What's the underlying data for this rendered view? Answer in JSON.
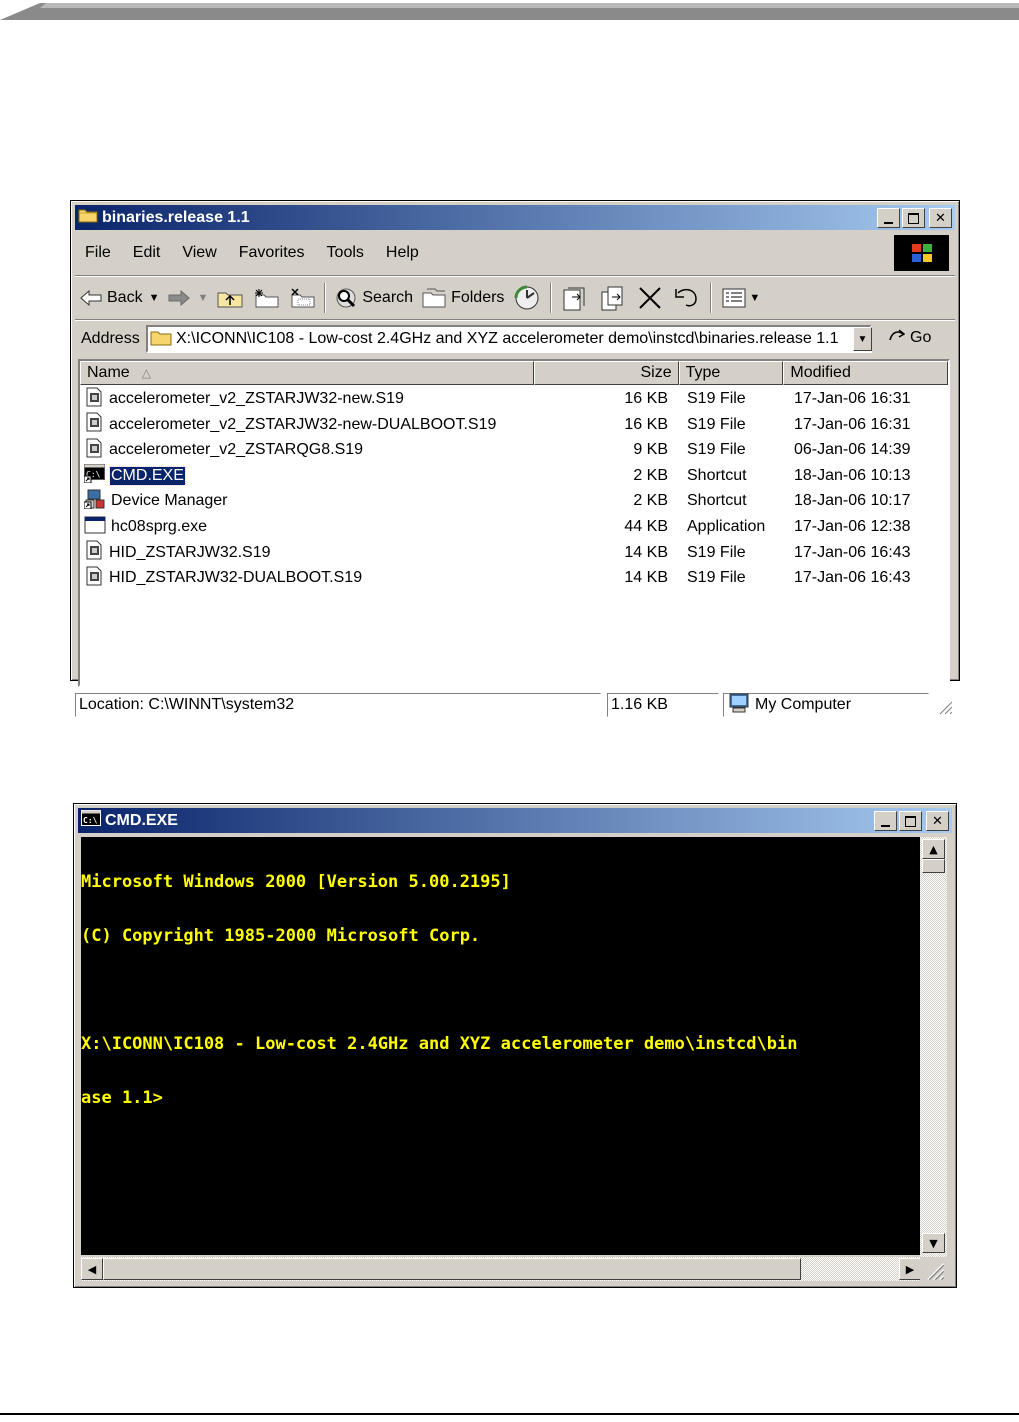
{
  "colors": {
    "titlebar_start": "#0a246a",
    "titlebar_end": "#a6caf0",
    "window_face": "#d4d0c8",
    "console_text": "#ffff00",
    "console_bg": "#000000",
    "selection": "#0a246a"
  },
  "explorer": {
    "title": "binaries.release 1.1",
    "title_icon": "folder-icon",
    "window_buttons": [
      "minimize",
      "maximize",
      "close"
    ],
    "menu": [
      "File",
      "Edit",
      "View",
      "Favorites",
      "Tools",
      "Help"
    ],
    "toolbar": {
      "back": "Back",
      "search": "Search",
      "folders": "Folders"
    },
    "address": {
      "label": "Address",
      "value": "X:\\ICONN\\IC108 - Low-cost 2.4GHz and XYZ accelerometer demo\\instcd\\binaries.release 1.1",
      "go": "Go"
    },
    "columns": [
      "Name",
      "Size",
      "Type",
      "Modified"
    ],
    "files": [
      {
        "name": "accelerometer_v2_ZSTARJW32-new.S19",
        "size": "16 KB",
        "type": "S19 File",
        "modified": "17-Jan-06 16:31",
        "icon": "document-icon"
      },
      {
        "name": "accelerometer_v2_ZSTARJW32-new-DUALBOOT.S19",
        "size": "16 KB",
        "type": "S19 File",
        "modified": "17-Jan-06 16:31",
        "icon": "document-icon"
      },
      {
        "name": "accelerometer_v2_ZSTARQG8.S19",
        "size": "9 KB",
        "type": "S19 File",
        "modified": "06-Jan-06 14:39",
        "icon": "document-icon"
      },
      {
        "name": "CMD.EXE",
        "size": "2 KB",
        "type": "Shortcut",
        "modified": "18-Jan-06 10:13",
        "icon": "console-icon",
        "selected": true
      },
      {
        "name": "Device Manager",
        "size": "2 KB",
        "type": "Shortcut",
        "modified": "18-Jan-06 10:17",
        "icon": "device-manager-icon"
      },
      {
        "name": "hc08sprg.exe",
        "size": "44 KB",
        "type": "Application",
        "modified": "17-Jan-06 12:38",
        "icon": "application-icon"
      },
      {
        "name": "HID_ZSTARJW32.S19",
        "size": "14 KB",
        "type": "S19 File",
        "modified": "17-Jan-06 16:43",
        "icon": "document-icon"
      },
      {
        "name": "HID_ZSTARJW32-DUALBOOT.S19",
        "size": "14 KB",
        "type": "S19 File",
        "modified": "17-Jan-06 16:43",
        "icon": "document-icon"
      }
    ],
    "status": {
      "location": "Location: C:\\WINNT\\system32",
      "size": "1.16 KB",
      "zone": "My Computer"
    }
  },
  "cmd": {
    "title": "CMD.EXE",
    "title_icon": "console-icon",
    "lines": [
      "Microsoft Windows 2000 [Version 5.00.2195]",
      "(C) Copyright 1985-2000 Microsoft Corp.",
      "",
      "X:\\ICONN\\IC108 - Low-cost 2.4GHz and XYZ accelerometer demo\\instcd\\bin",
      "ase 1.1>"
    ]
  }
}
